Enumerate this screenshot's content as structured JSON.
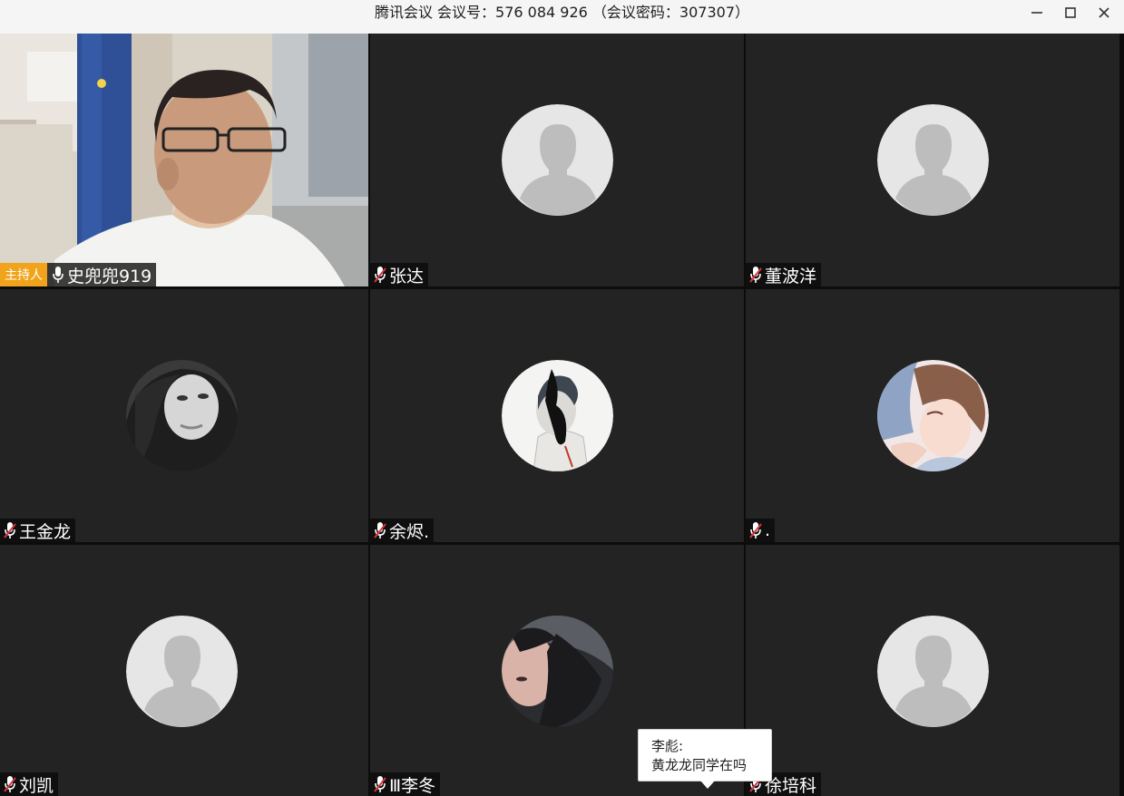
{
  "window": {
    "title": "腾讯会议 会议号：576 084 926 （会议密码：307307）",
    "controls": [
      "minimize-icon",
      "maximize-icon",
      "close-icon"
    ]
  },
  "participants": [
    {
      "name": "史兜兜919",
      "host_label": "主持人",
      "mic": "on",
      "video": "camera"
    },
    {
      "name": "张达",
      "mic": "muted",
      "avatar": "default"
    },
    {
      "name": "董波洋",
      "mic": "muted",
      "avatar": "default"
    },
    {
      "name": "王金龙",
      "mic": "muted",
      "avatar": "photo"
    },
    {
      "name": "余烬.",
      "mic": "muted",
      "avatar": "illustration"
    },
    {
      "name": ".",
      "mic": "muted",
      "avatar": "illustration"
    },
    {
      "name": "刘凯",
      "mic": "muted",
      "avatar": "default"
    },
    {
      "name": "Ⅲ李冬",
      "mic": "muted",
      "avatar": "photo"
    },
    {
      "name": "徐培科",
      "mic": "muted",
      "avatar": "default"
    }
  ],
  "chat_bubble": {
    "sender": "李彪:",
    "message": "黄龙龙同学在吗"
  },
  "colors": {
    "tile_bg": "#232323",
    "host_badge": "#f0a31b",
    "muted_mic": "#d9363e"
  }
}
